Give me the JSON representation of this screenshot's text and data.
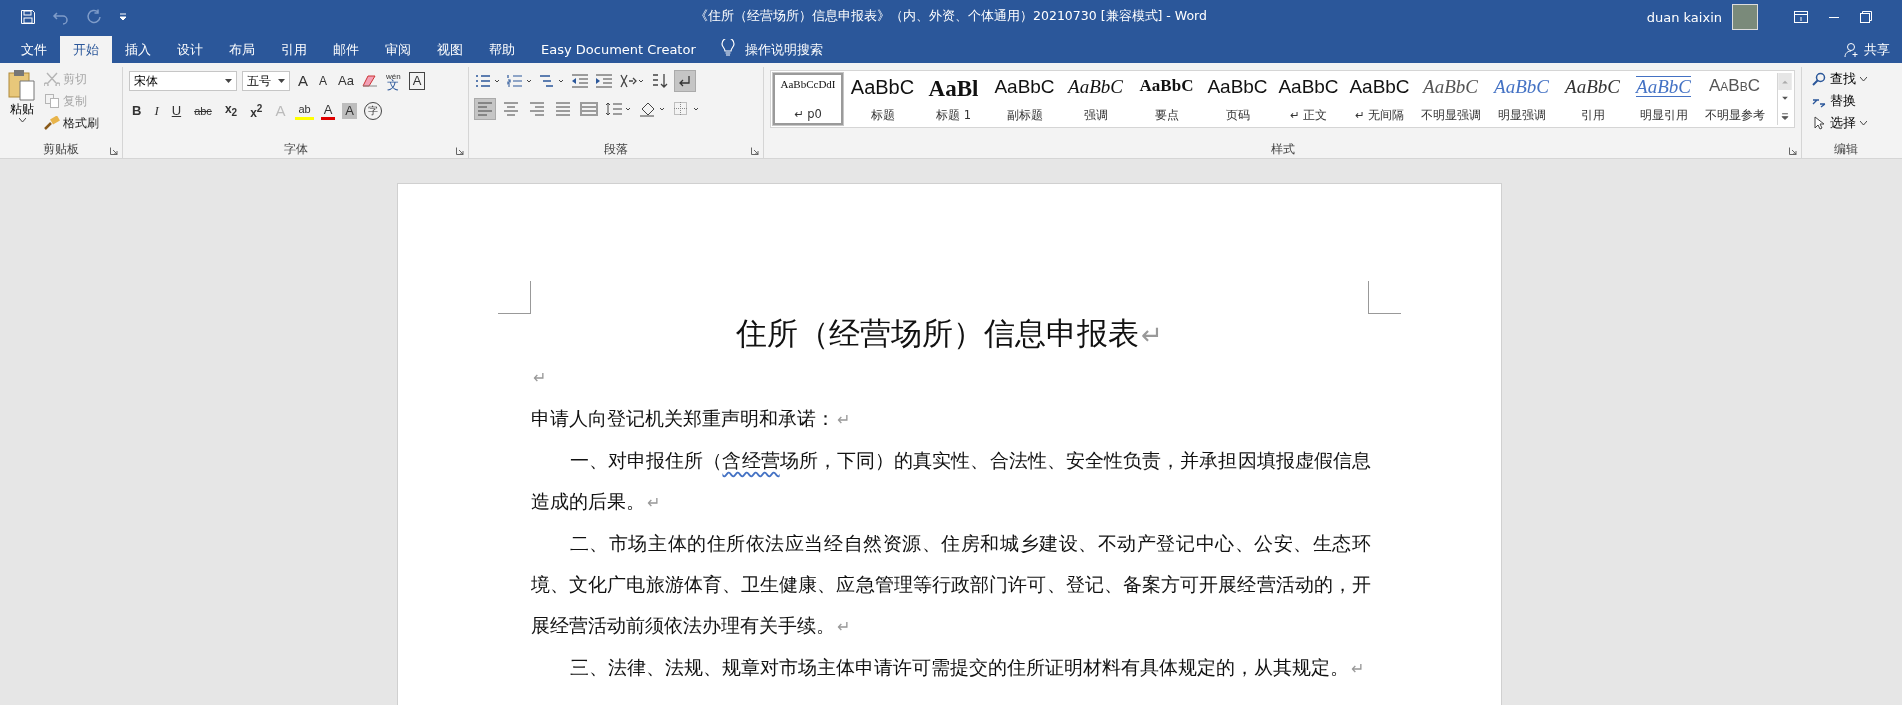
{
  "window": {
    "title": "《住所（经营场所）信息申报表》（内、外资、个体通用）20210730 [兼容模式]  -  Word",
    "account": "duan kaixin"
  },
  "tabs": [
    {
      "label": "文件",
      "selected": false
    },
    {
      "label": "开始",
      "selected": true
    },
    {
      "label": "插入",
      "selected": false
    },
    {
      "label": "设计",
      "selected": false
    },
    {
      "label": "布局",
      "selected": false
    },
    {
      "label": "引用",
      "selected": false
    },
    {
      "label": "邮件",
      "selected": false
    },
    {
      "label": "审阅",
      "selected": false
    },
    {
      "label": "视图",
      "selected": false
    },
    {
      "label": "帮助",
      "selected": false
    },
    {
      "label": "Easy Document Creator",
      "selected": false
    }
  ],
  "tell_me": "操作说明搜索",
  "share": "共享",
  "ribbon": {
    "clipboard": {
      "label": "剪贴板",
      "paste": "粘贴",
      "commands": [
        {
          "label": "剪切",
          "kind": "cut",
          "disabled": true
        },
        {
          "label": "复制",
          "kind": "copy",
          "disabled": true
        },
        {
          "label": "格式刷",
          "kind": "painter",
          "disabled": false
        }
      ]
    },
    "font": {
      "label": "字体",
      "font_name": "宋体",
      "font_size": "五号",
      "row1": [
        {
          "kind": "grow",
          "glyph": "A"
        },
        {
          "kind": "shrink",
          "glyph": "A"
        },
        {
          "kind": "case",
          "glyph": "Aa"
        },
        {
          "kind": "clear"
        },
        {
          "kind": "phonetic",
          "glyph": "wén"
        },
        {
          "kind": "border",
          "glyph": "A"
        }
      ],
      "row2": [
        {
          "kind": "bold",
          "glyph": "B"
        },
        {
          "kind": "italic",
          "glyph": "I"
        },
        {
          "kind": "underline",
          "glyph": "U"
        },
        {
          "kind": "strike",
          "glyph": "abc"
        },
        {
          "kind": "sub",
          "glyph": "x$_{2}$"
        },
        {
          "kind": "sup",
          "glyph": "x$^{2}$"
        },
        {
          "kind": "effects",
          "glyph": "A"
        },
        {
          "kind": "highlight",
          "glyph": "ab"
        },
        {
          "kind": "color",
          "glyph": "A"
        },
        {
          "kind": "shading",
          "glyph": "A"
        },
        {
          "kind": "enclose",
          "glyph": "字"
        }
      ],
      "phonetic_base": "文"
    },
    "paragraph": {
      "label": "段落",
      "show_marks": true,
      "alignments": [
        {
          "kind": "left",
          "selected": true
        },
        {
          "kind": "center",
          "selected": false
        },
        {
          "kind": "right",
          "selected": false
        },
        {
          "kind": "justify",
          "selected": false
        },
        {
          "kind": "distributed",
          "selected": false
        }
      ]
    },
    "styles": {
      "label": "样式",
      "items": [
        {
          "sample": "AaBbCcDdI",
          "label": "↵ p0",
          "kind": "small",
          "selected": true
        },
        {
          "sample": "AaBbC",
          "label": "标题",
          "kind": "heading",
          "selected": false
        },
        {
          "sample": "AaBl",
          "label": "标题 1",
          "kind": "title",
          "selected": false
        },
        {
          "sample": "AaBbC",
          "label": "副标题",
          "kind": "plain",
          "selected": false
        },
        {
          "sample": "AaBbC",
          "label": "强调",
          "kind": "italic",
          "selected": false
        },
        {
          "sample": "AaBbC",
          "label": "要点",
          "kind": "bold",
          "selected": false
        },
        {
          "sample": "AaBbC",
          "label": "页码",
          "kind": "plain",
          "selected": false
        },
        {
          "sample": "AaBbC",
          "label": "↵ 正文",
          "kind": "plain",
          "selected": false
        },
        {
          "sample": "AaBbC",
          "label": "↵ 无间隔",
          "kind": "plain",
          "selected": false
        },
        {
          "sample": "AaBbC",
          "label": "不明显强调",
          "kind": "subtle",
          "selected": false
        },
        {
          "sample": "AaBbC",
          "label": "明显强调",
          "kind": "intense",
          "selected": false
        },
        {
          "sample": "AaBbC",
          "label": "引用",
          "kind": "quote",
          "selected": false
        },
        {
          "sample": "AaBbC",
          "label": "明显引用",
          "kind": "intense-quote",
          "selected": false
        },
        {
          "sample": "AaBbC",
          "label": "不明显参考",
          "kind": "reference",
          "selected": false
        }
      ]
    },
    "editing": {
      "label": "编辑",
      "commands": [
        {
          "label": "查找",
          "kind": "find"
        },
        {
          "label": "替换",
          "kind": "replace"
        },
        {
          "label": "选择",
          "kind": "select"
        }
      ]
    }
  },
  "document": {
    "title": "住所（经营场所）信息申报表",
    "mark": "↵",
    "paragraphs": [
      {
        "kind": "empty"
      },
      {
        "kind": "text",
        "indent": false,
        "parts": [
          {
            "text": "申请人向登记机关郑重声明和承诺：",
            "flagged": false
          }
        ]
      },
      {
        "kind": "text",
        "indent": true,
        "parts": [
          {
            "text": "一、对申报住所（",
            "flagged": false
          },
          {
            "text": "含经营",
            "flagged": true
          },
          {
            "text": "场所，下同）的真实性、合法性、安全性负责，并承担因填报虚假信息造成的后果。",
            "flagged": false
          }
        ]
      },
      {
        "kind": "text",
        "indent": true,
        "parts": [
          {
            "text": "二、市场主体的住所依法应当经自然资源、住房和城乡建设、不动产登记中心、公安、生态环境、文化广电旅游体育、卫生健康、应急管理等行政部门许可、登记、备案方可开展经营活动的，开展经营活动前须依法办理有关手续。",
            "flagged": false
          }
        ]
      },
      {
        "kind": "text",
        "indent": true,
        "parts": [
          {
            "text": "三、法律、法规、规章对市场主体申请许可需提交的住所证明材料有具体规定的，从其规定。",
            "flagged": false
          }
        ]
      }
    ]
  }
}
